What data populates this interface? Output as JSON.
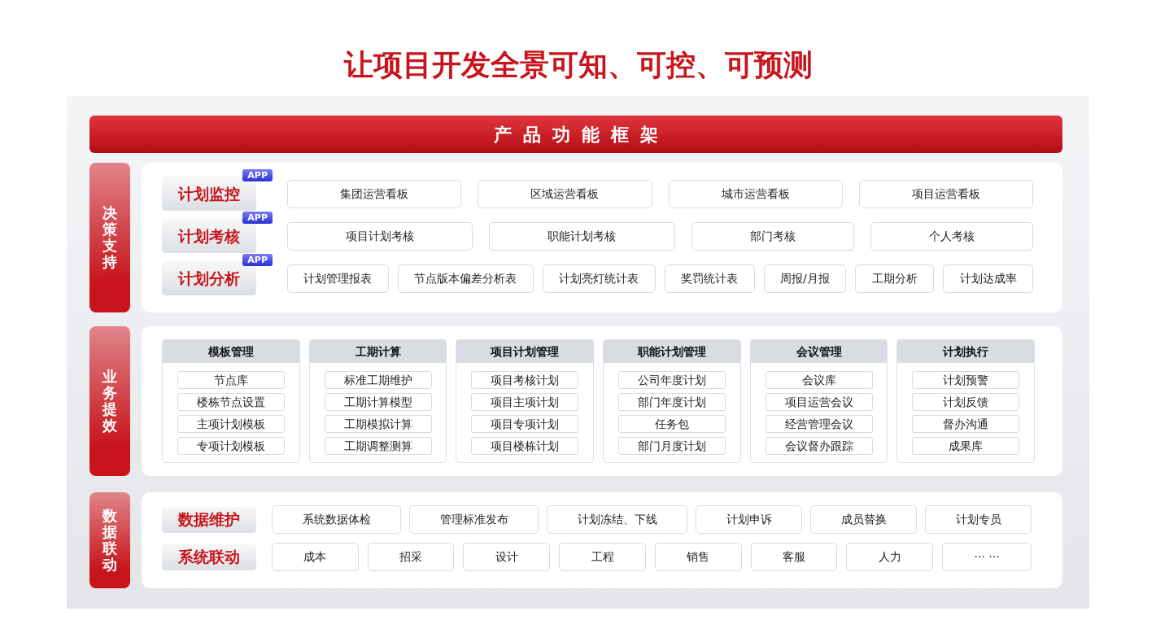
{
  "title": "让项目开发全景可知、可控、可预测",
  "framework_header": "产品功能框架",
  "sections": [
    {
      "label": "决策支持",
      "kind": "rows",
      "rows": [
        {
          "label": "计划监控",
          "badge": "APP",
          "items": [
            "集团运营看板",
            "区域运营看板",
            "城市运营看板",
            "项目运营看板"
          ]
        },
        {
          "label": "计划考核",
          "badge": "APP",
          "items": [
            "项目计划考核",
            "职能计划考核",
            "部门考核",
            "个人考核"
          ]
        },
        {
          "label": "计划分析",
          "badge": "APP",
          "items": [
            "计划管理报表",
            "节点版本偏差分析表",
            "计划亮灯统计表",
            "奖罚统计表",
            "周报/月报",
            "工期分析",
            "计划达成率"
          ]
        }
      ]
    },
    {
      "label": "业务提效",
      "kind": "columns",
      "columns": [
        {
          "title": "模板管理",
          "items": [
            "节点库",
            "楼栋节点设置",
            "主项计划模板",
            "专项计划模板"
          ]
        },
        {
          "title": "工期计算",
          "items": [
            "标准工期维护",
            "工期计算模型",
            "工期模拟计算",
            "工期调整测算"
          ]
        },
        {
          "title": "项目计划管理",
          "items": [
            "项目考核计划",
            "项目主项计划",
            "项目专项计划",
            "项目楼栋计划"
          ]
        },
        {
          "title": "职能计划管理",
          "items": [
            "公司年度计划",
            "部门年度计划",
            "任务包",
            "部门月度计划"
          ]
        },
        {
          "title": "会议管理",
          "items": [
            "会议库",
            "项目运营会议",
            "经营管理会议",
            "会议督办跟踪"
          ]
        },
        {
          "title": "计划执行",
          "items": [
            "计划预警",
            "计划反馈",
            "督办沟通",
            "成果库"
          ]
        }
      ]
    },
    {
      "label": "数据联动",
      "kind": "rows",
      "rows": [
        {
          "label": "数据维护",
          "items": [
            "系统数据体检",
            "管理标准发布",
            "计划冻结、下线",
            "计划申诉",
            "成员替换",
            "计划专员"
          ]
        },
        {
          "label": "系统联动",
          "items": [
            "成本",
            "招采",
            "设计",
            "工程",
            "销售",
            "客服",
            "人力",
            "··· ···"
          ]
        }
      ]
    }
  ]
}
